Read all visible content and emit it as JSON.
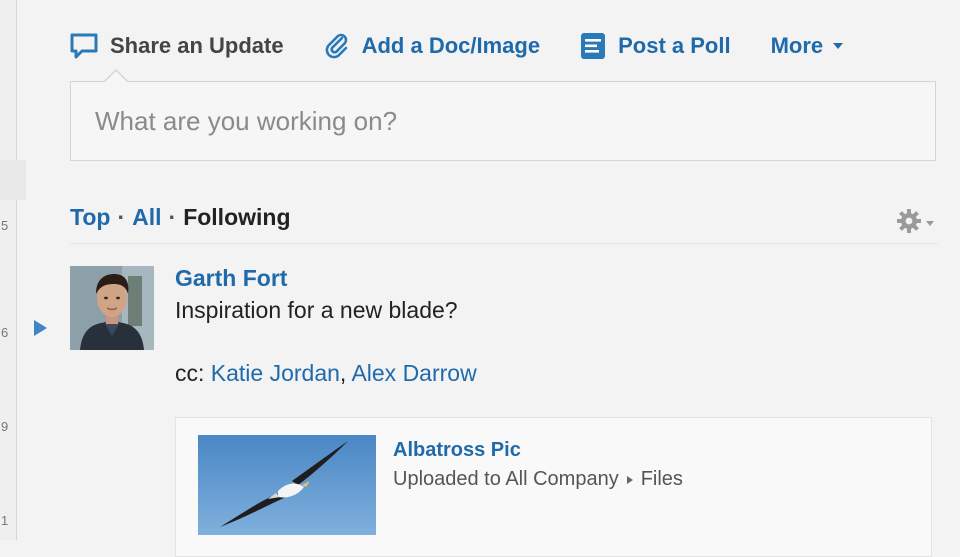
{
  "gutter_numbers": [
    "5",
    "6",
    "9",
    "1"
  ],
  "publisher": {
    "tabs": [
      {
        "label": "Share an Update",
        "icon": "speech-bubble-icon"
      },
      {
        "label": "Add a Doc/Image",
        "icon": "paperclip-icon"
      },
      {
        "label": "Post a Poll",
        "icon": "poll-list-icon"
      },
      {
        "label": "More",
        "icon": "chevron-down-icon"
      }
    ],
    "placeholder": "What are you working on?"
  },
  "filters": {
    "top": "Top",
    "all": "All",
    "following": "Following",
    "separator": "·",
    "settings_icon": "gear-icon"
  },
  "post": {
    "author": "Garth Fort",
    "body": "Inspiration for a new blade?",
    "cc_label": "cc:",
    "cc_people": [
      "Katie Jordan",
      "Alex Darrow"
    ],
    "cc_separator": ",",
    "attachment": {
      "title": "Albatross Pic",
      "meta_prefix": "Uploaded to All Company",
      "meta_suffix": "Files"
    }
  },
  "colors": {
    "link": "#1f6aab",
    "text": "#222222",
    "background": "#f3f3f3",
    "feed_marker": "#3d86c6"
  }
}
